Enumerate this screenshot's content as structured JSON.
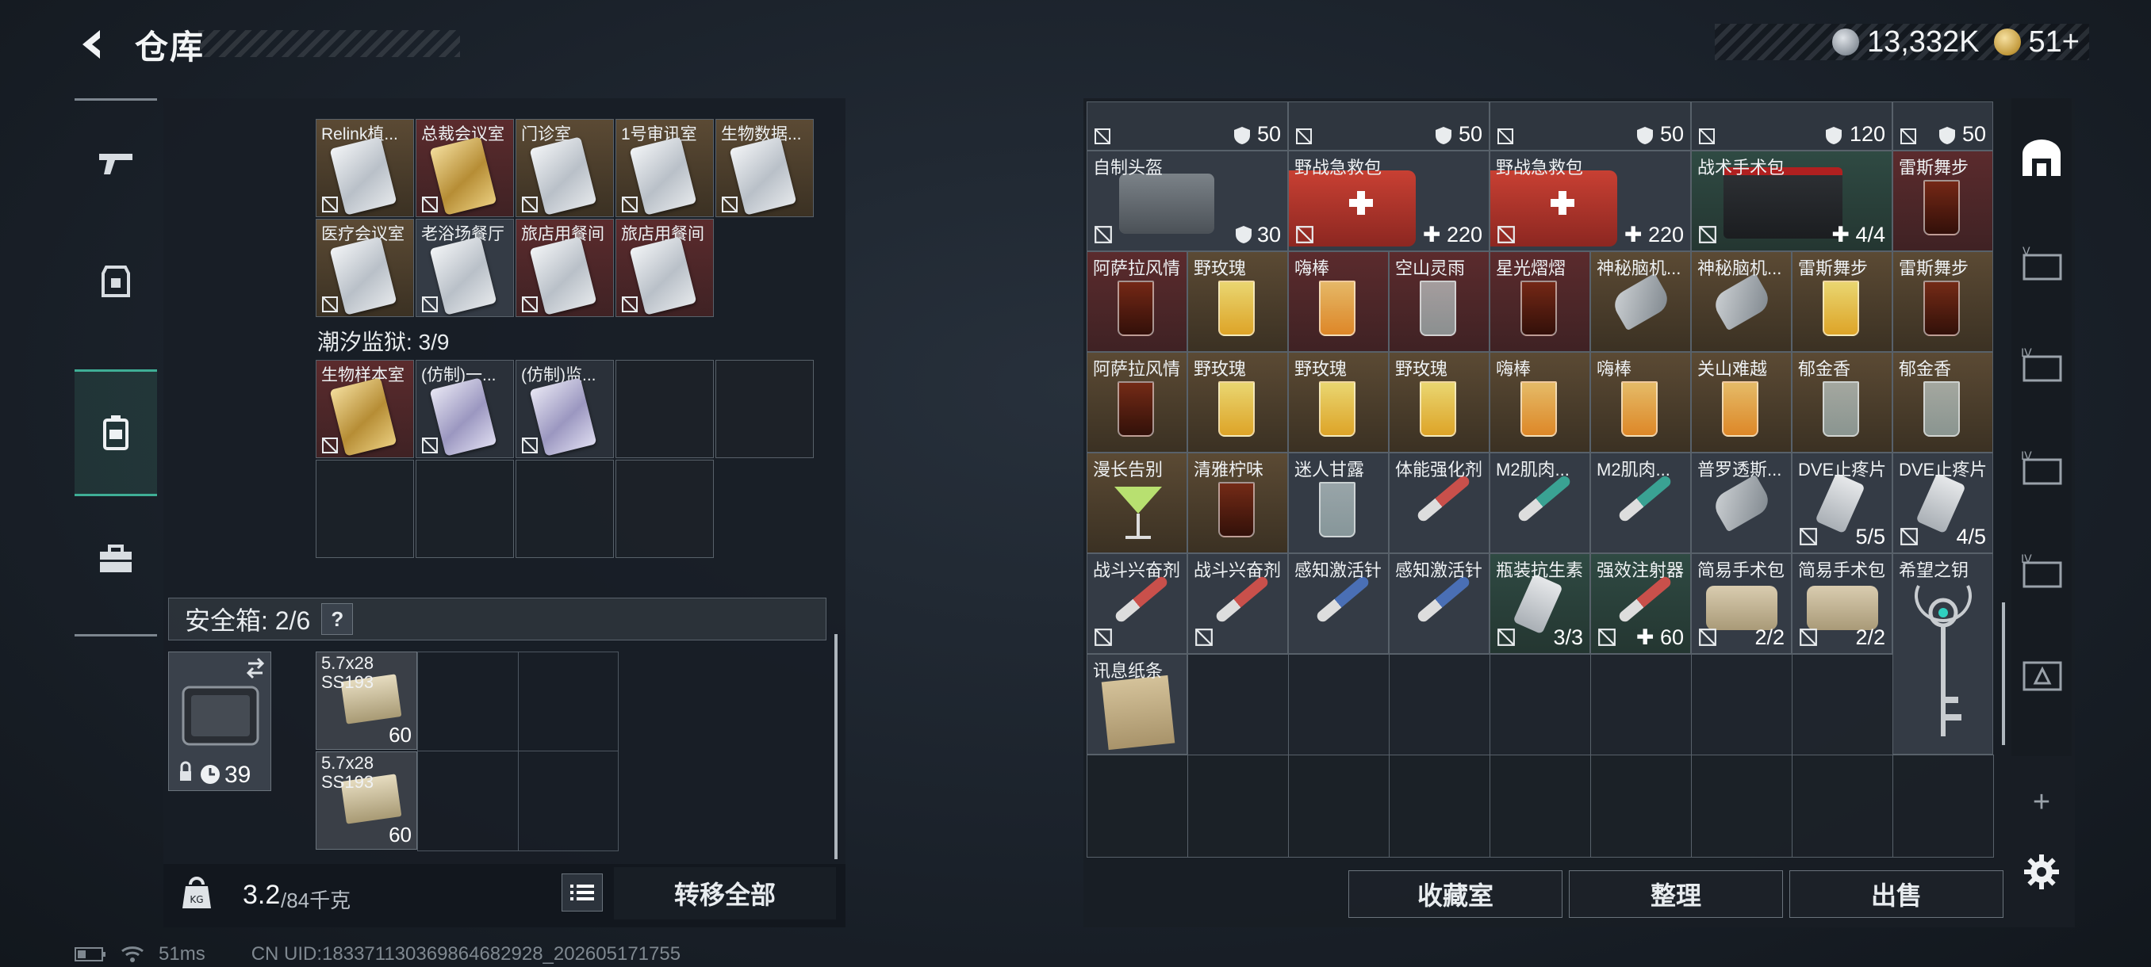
{
  "header": {
    "title": "仓库",
    "currency": [
      {
        "icon": "silver-coin-icon",
        "value": "13,332K"
      },
      {
        "icon": "gold-coin-icon",
        "value": "51+"
      }
    ]
  },
  "left_nav": [
    "weapon-icon",
    "armor-icon",
    "backpack-icon",
    "briefcase-icon"
  ],
  "left_panel": {
    "rows": [
      [
        {
          "label": "Relink植...",
          "bg": "gold"
        },
        {
          "label": "总裁会议室",
          "bg": "red",
          "card": "goldcard"
        },
        {
          "label": "门诊室",
          "bg": "gold"
        },
        {
          "label": "1号审讯室",
          "bg": "gold"
        },
        {
          "label": "生物数据...",
          "bg": "gold"
        }
      ],
      [
        {
          "label": "医疗会议室",
          "bg": "gold"
        },
        {
          "label": "老浴场餐厅",
          "bg": "grey"
        },
        {
          "label": "旅店用餐间",
          "bg": "red"
        },
        {
          "label": "旅店用餐间",
          "bg": "red"
        }
      ]
    ],
    "section_title": "潮汐监狱: 3/9",
    "tide_items": [
      {
        "label": "生物样本室",
        "bg": "red",
        "card": "goldcard"
      },
      {
        "label": "(仿制)一...",
        "bg": "dark",
        "card": "purple"
      },
      {
        "label": "(仿制)监...",
        "bg": "dark",
        "card": "purple"
      }
    ],
    "safe_box": {
      "title": "安全箱: 2/6",
      "help": "?",
      "timer": "39天",
      "ammo": [
        {
          "label_line1": "5.7x28",
          "label_line2": "SS193",
          "count": "60"
        },
        {
          "label_line1": "5.7x28",
          "label_line2": "SS193",
          "count": "60"
        }
      ]
    },
    "weight": {
      "current": "3.2",
      "max": "/84千克"
    },
    "transfer_all": "转移全部"
  },
  "right_panel": {
    "top_row_counts": [
      "50",
      "50",
      "50",
      "120",
      "50"
    ],
    "rows": [
      [
        {
          "label": "自制头盔",
          "bg": "grey",
          "count": "30",
          "kind": "helmet",
          "ico": "armor"
        },
        {
          "label": "野战急救包",
          "bg": "grey",
          "count": "220",
          "kind": "medkit",
          "ico": "plus"
        },
        {
          "label": "野战急救包",
          "bg": "grey",
          "count": "220",
          "kind": "medkit",
          "ico": "plus"
        },
        {
          "label": "战术手术包",
          "bg": "green",
          "count": "4/4",
          "kind": "surgery",
          "ico": "plus"
        },
        {
          "label": "雷斯舞步",
          "bg": "red",
          "count": "",
          "kind": "cola"
        }
      ],
      [
        {
          "label": "阿萨拉风情",
          "bg": "red",
          "kind": "cola"
        },
        {
          "label": "野玫瑰",
          "bg": "gold",
          "kind": "yellow"
        },
        {
          "label": "嗨棒",
          "bg": "red",
          "kind": "orange"
        },
        {
          "label": "空山灵雨",
          "bg": "red",
          "kind": "clear"
        },
        {
          "label": "星光熠熠",
          "bg": "red",
          "kind": "cola"
        },
        {
          "label": "神秘脑机...",
          "bg": "gold",
          "kind": "device"
        },
        {
          "label": "神秘脑机...",
          "bg": "gold",
          "kind": "device"
        },
        {
          "label": "雷斯舞步",
          "bg": "gold",
          "kind": "yellow"
        },
        {
          "label": "雷斯舞步",
          "bg": "gold",
          "kind": "cola"
        }
      ],
      [
        {
          "label": "阿萨拉风情",
          "bg": "gold",
          "kind": "cola"
        },
        {
          "label": "野玫瑰",
          "bg": "gold",
          "kind": "yellow"
        },
        {
          "label": "野玫瑰",
          "bg": "gold",
          "kind": "yellow"
        },
        {
          "label": "野玫瑰",
          "bg": "gold",
          "kind": "yellow"
        },
        {
          "label": "嗨棒",
          "bg": "gold",
          "kind": "orange"
        },
        {
          "label": "嗨棒",
          "bg": "gold",
          "kind": "orange"
        },
        {
          "label": "关山难越",
          "bg": "gold",
          "kind": "orange"
        },
        {
          "label": "郁金香",
          "bg": "gold",
          "kind": "clear"
        },
        {
          "label": "郁金香",
          "bg": "gold",
          "kind": "clear"
        }
      ],
      [
        {
          "label": "漫长告别",
          "bg": "gold",
          "kind": "cocktail"
        },
        {
          "label": "清雅柠味",
          "bg": "gold",
          "kind": "cola"
        },
        {
          "label": "迷人甘露",
          "bg": "grey",
          "kind": "clear"
        },
        {
          "label": "体能强化剂",
          "bg": "grey",
          "kind": "syringe-red"
        },
        {
          "label": "M2肌肉...",
          "bg": "grey",
          "kind": "syringe-teal"
        },
        {
          "label": "M2肌肉...",
          "bg": "grey",
          "kind": "syringe-teal"
        },
        {
          "label": "普罗透斯...",
          "bg": "grey",
          "kind": "device"
        },
        {
          "label": "DVE止疼片",
          "bg": "grey",
          "count": "5/5",
          "kind": "pill",
          "ico": "nohand"
        },
        {
          "label": "DVE止疼片",
          "bg": "grey",
          "count": "4/5",
          "kind": "pill",
          "ico": "nohand"
        }
      ],
      [
        {
          "label": "战斗兴奋剂",
          "bg": "grey",
          "kind": "syringe-red",
          "ico": "nohand"
        },
        {
          "label": "战斗兴奋剂",
          "bg": "grey",
          "kind": "syringe-red",
          "ico": "nohand"
        },
        {
          "label": "感知激活针",
          "bg": "grey",
          "kind": "syringe-blue"
        },
        {
          "label": "感知激活针",
          "bg": "grey",
          "kind": "syringe-blue"
        },
        {
          "label": "瓶装抗生素",
          "bg": "green",
          "count": "3/3",
          "kind": "pill",
          "ico": "nohand"
        },
        {
          "label": "强效注射器",
          "bg": "green",
          "count": "60",
          "kind": "syringe-red",
          "ico": "plus"
        },
        {
          "label": "简易手术包",
          "bg": "grey",
          "count": "2/2",
          "kind": "pouch",
          "ico": "nohand"
        },
        {
          "label": "简易手术包",
          "bg": "grey",
          "count": "2/2",
          "kind": "pouch",
          "ico": "nohand"
        },
        {
          "label": "希望之钥",
          "bg": "grey",
          "kind": "key"
        }
      ],
      [
        {
          "label": "讯息纸条",
          "bg": "grey",
          "kind": "paper"
        }
      ]
    ],
    "buttons": {
      "collection": "收藏室",
      "sort": "整理",
      "sell": "出售"
    }
  },
  "right_nav": [
    "safehouse-icon",
    "case-v-icon",
    "case-iv-icon",
    "case-iv-2-icon",
    "case-iv-3-icon",
    "case-warning-icon",
    "add-icon",
    "settings-icon"
  ],
  "status": {
    "ping": "51ms",
    "uid": "CN UID:1833711303698646829​28_202605171755"
  }
}
